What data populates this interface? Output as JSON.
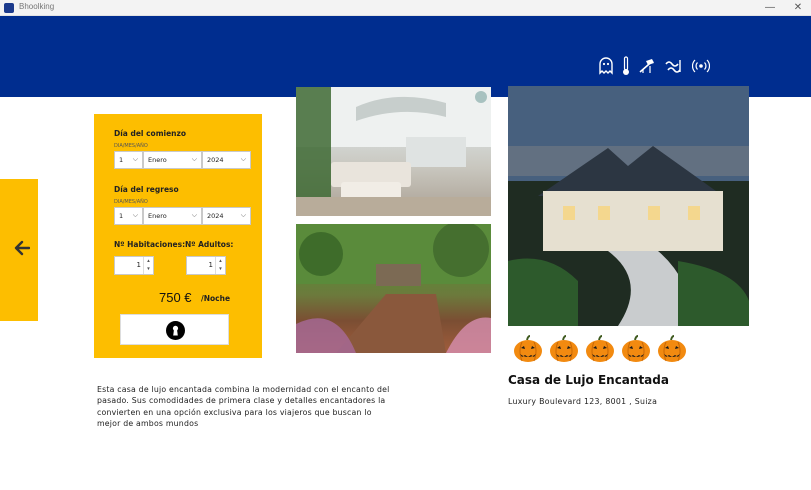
{
  "window": {
    "title": "Bhoolking",
    "minimize_glyph": "—",
    "close_glyph": "✕"
  },
  "header": {
    "amenities": [
      "ghost-icon",
      "thermometer-icon",
      "sunbed-icon",
      "pool-icon",
      "wifi-icon"
    ]
  },
  "booking": {
    "start": {
      "label": "Día del comienzo",
      "hint": "DIA/MES/AÑO",
      "day": "1",
      "month": "Enero",
      "year": "2024"
    },
    "end": {
      "label": "Día del regreso",
      "hint": "DIA/MES/AÑO",
      "day": "1",
      "month": "Enero",
      "year": "2024"
    },
    "rooms": {
      "label": "Nº Habitaciones:",
      "value": "1"
    },
    "adults": {
      "label": "Nº Adultos:",
      "value": "1"
    },
    "price": "750 €",
    "per_night": "/Noche",
    "book_icon": "keyhole-icon"
  },
  "rating": {
    "icon": "pumpkin-icon",
    "count": 5
  },
  "property": {
    "title": "Casa de Lujo Encantada",
    "address": "Luxury Boulevard 123, 8001 , Suiza",
    "description": "Esta casa de lujo encantada combina la modernidad con el encanto del pasado. Sus comodidades de primera clase y detalles encantadores la convierten en una opción exclusiva para los viajeros que buscan lo mejor de ambos mundos"
  },
  "colors": {
    "header": "#002d8f",
    "accent": "#fdbe00"
  }
}
